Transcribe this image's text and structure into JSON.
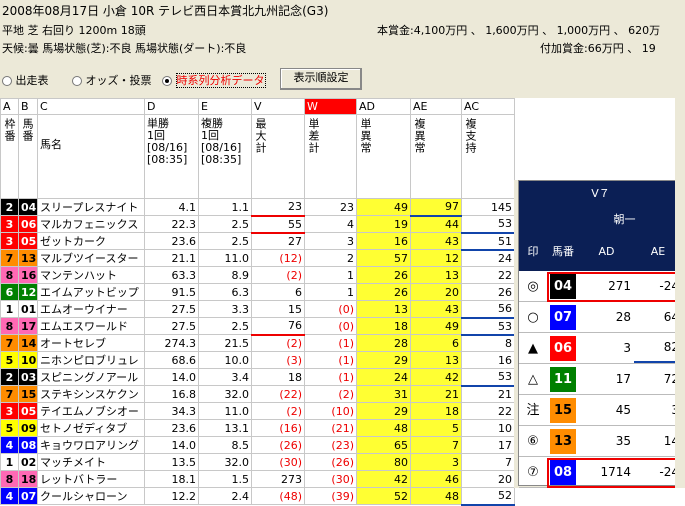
{
  "header": {
    "race_line": "2008年08月17日 小倉 10R テレビ西日本賞北九州記念(G3)",
    "track_line": "平地 芝 右回り 1200m 18頭",
    "condition_line": "天候:曇 馬場状態(芝):不良 馬場状態(ダート):不良",
    "prize_line": "本賞金:4,100万円 、 1,600万円 、 1,000万円 、 620万",
    "extra_prize_line": "付加賞金:66万円 、 19"
  },
  "options": {
    "radio1": "出走表",
    "radio2": "オッズ・投票",
    "radio3": "時系列分析データ",
    "display_button": "表示順設定"
  },
  "columns": {
    "letters": [
      "A",
      "B",
      "C",
      "D",
      "E",
      "V",
      "W",
      "AD",
      "AE",
      "AC"
    ],
    "h_waku": "枠番",
    "h_uma": "馬番",
    "h_name": "馬名",
    "h_tan": "単勝\n1回\n[08/16]\n[08:35]",
    "h_fuku": "複勝\n1回\n[08/16]\n[08:35]",
    "h_max": "最大計",
    "h_diff": "単差計",
    "h_tan_ab": "単異常",
    "h_fuku_ab": "複異常",
    "h_fuku_sup": "複支持"
  },
  "rows": [
    {
      "waku": "2",
      "uma": "04",
      "name": "スリープレスナイト",
      "tan": "4.1",
      "fuku": "1.1",
      "max": "23",
      "diff": "23",
      "ad": "49",
      "ae": "97",
      "ac": "145",
      "wc": "#000000",
      "tc": "#ffffff"
    },
    {
      "waku": "3",
      "uma": "06",
      "name": "マルカフェニックス",
      "tan": "22.3",
      "fuku": "2.5",
      "max": "55",
      "diff": "4",
      "ad": "19",
      "ae": "44",
      "ac": "53",
      "wc": "#ff0000",
      "tc": "#ffffff"
    },
    {
      "waku": "3",
      "uma": "05",
      "name": "ゼットカーク",
      "tan": "23.6",
      "fuku": "2.5",
      "max": "27",
      "diff": "3",
      "ad": "16",
      "ae": "43",
      "ac": "51",
      "wc": "#ff0000",
      "tc": "#ffffff"
    },
    {
      "waku": "7",
      "uma": "13",
      "name": "マルブツイースター",
      "tan": "21.1",
      "fuku": "11.0",
      "max": "(12)",
      "diff": "2",
      "ad": "57",
      "ae": "12",
      "ac": "24",
      "wc": "#ff8c00",
      "tc": "#000000"
    },
    {
      "waku": "8",
      "uma": "16",
      "name": "マンテンハット",
      "tan": "63.3",
      "fuku": "8.9",
      "max": "(2)",
      "diff": "1",
      "ad": "26",
      "ae": "13",
      "ac": "22",
      "wc": "#ff69b4",
      "tc": "#000000"
    },
    {
      "waku": "6",
      "uma": "12",
      "name": "エイムアットビップ",
      "tan": "91.5",
      "fuku": "6.3",
      "max": "6",
      "diff": "1",
      "ad": "26",
      "ae": "20",
      "ac": "26",
      "wc": "#008000",
      "tc": "#ffffff"
    },
    {
      "waku": "1",
      "uma": "01",
      "name": "エムオーウイナー",
      "tan": "27.5",
      "fuku": "3.3",
      "max": "15",
      "diff": "(0)",
      "ad": "13",
      "ae": "43",
      "ac": "56",
      "wc": "#ffffff",
      "tc": "#000000"
    },
    {
      "waku": "8",
      "uma": "17",
      "name": "エムエスワールド",
      "tan": "27.5",
      "fuku": "2.5",
      "max": "76",
      "diff": "(0)",
      "ad": "18",
      "ae": "49",
      "ac": "53",
      "wc": "#ff69b4",
      "tc": "#000000"
    },
    {
      "waku": "7",
      "uma": "14",
      "name": "オートセレブ",
      "tan": "274.3",
      "fuku": "21.5",
      "max": "(2)",
      "diff": "(1)",
      "ad": "28",
      "ae": "6",
      "ac": "8",
      "wc": "#ff8c00",
      "tc": "#000000"
    },
    {
      "waku": "5",
      "uma": "10",
      "name": "ニホンピロブリュレ",
      "tan": "68.6",
      "fuku": "10.0",
      "max": "(3)",
      "diff": "(1)",
      "ad": "29",
      "ae": "13",
      "ac": "16",
      "wc": "#ffff00",
      "tc": "#000000"
    },
    {
      "waku": "2",
      "uma": "03",
      "name": "スピニングノアール",
      "tan": "14.0",
      "fuku": "3.4",
      "max": "18",
      "diff": "(1)",
      "ad": "24",
      "ae": "42",
      "ac": "53",
      "wc": "#000000",
      "tc": "#ffffff"
    },
    {
      "waku": "7",
      "uma": "15",
      "name": "ステキシンスケクン",
      "tan": "16.8",
      "fuku": "32.0",
      "max": "(22)",
      "diff": "(2)",
      "ad": "31",
      "ae": "21",
      "ac": "21",
      "wc": "#ff8c00",
      "tc": "#000000"
    },
    {
      "waku": "3",
      "uma": "05",
      "name": "テイエムノブシオー",
      "tan": "34.3",
      "fuku": "11.0",
      "max": "(2)",
      "diff": "(10)",
      "ad": "29",
      "ae": "18",
      "ac": "22",
      "wc": "#ff0000",
      "tc": "#ffffff"
    },
    {
      "waku": "5",
      "uma": "09",
      "name": "セトノゼディタブ",
      "tan": "23.6",
      "fuku": "13.1",
      "max": "(16)",
      "diff": "(21)",
      "ad": "48",
      "ae": "5",
      "ac": "10",
      "wc": "#ffff00",
      "tc": "#000000"
    },
    {
      "waku": "4",
      "uma": "08",
      "name": "キョウワロアリング",
      "tan": "14.0",
      "fuku": "8.5",
      "max": "(26)",
      "diff": "(23)",
      "ad": "65",
      "ae": "7",
      "ac": "17",
      "wc": "#0000ff",
      "tc": "#ffffff"
    },
    {
      "waku": "1",
      "uma": "02",
      "name": "マッチメイト",
      "tan": "13.5",
      "fuku": "32.0",
      "max": "(30)",
      "diff": "(26)",
      "ad": "80",
      "ae": "3",
      "ac": "7",
      "wc": "#ffffff",
      "tc": "#000000"
    },
    {
      "waku": "8",
      "uma": "18",
      "name": "レットバトラー",
      "tan": "18.1",
      "fuku": "1.5",
      "max": "273",
      "diff": "(30)",
      "ad": "42",
      "ae": "46",
      "ac": "20",
      "wc": "#ff69b4",
      "tc": "#000000"
    },
    {
      "waku": "4",
      "uma": "07",
      "name": "クールシャローン",
      "tan": "12.2",
      "fuku": "2.4",
      "max": "(48)",
      "diff": "(39)",
      "ad": "52",
      "ae": "48",
      "ac": "52",
      "wc": "#0000ff",
      "tc": "#ffffff"
    }
  ],
  "panel": {
    "title": "V７",
    "sub": "朝一",
    "h_mark": "印",
    "h_uma": "馬番",
    "h_ad": "AD",
    "h_ae": "AE",
    "rows": [
      {
        "mark": "◎",
        "uma": "04",
        "ad": "271",
        "ae": "-24",
        "bg": "#000000",
        "fg": "#ffffff"
      },
      {
        "mark": "○",
        "uma": "07",
        "ad": "28",
        "ae": "64",
        "bg": "#0000ff",
        "fg": "#ffffff"
      },
      {
        "mark": "▲",
        "uma": "06",
        "ad": "3",
        "ae": "82",
        "bg": "#ff0000",
        "fg": "#ffffff"
      },
      {
        "mark": "△",
        "uma": "11",
        "ad": "17",
        "ae": "72",
        "bg": "#008000",
        "fg": "#ffffff"
      },
      {
        "mark": "注",
        "uma": "15",
        "ad": "45",
        "ae": "3",
        "bg": "#ff8c00",
        "fg": "#000000"
      },
      {
        "mark": "⑥",
        "uma": "13",
        "ad": "35",
        "ae": "14",
        "bg": "#ff8c00",
        "fg": "#000000"
      },
      {
        "mark": "⑦",
        "uma": "08",
        "ad": "1714",
        "ae": "-24",
        "bg": "#0000ff",
        "fg": "#ffffff"
      }
    ]
  }
}
